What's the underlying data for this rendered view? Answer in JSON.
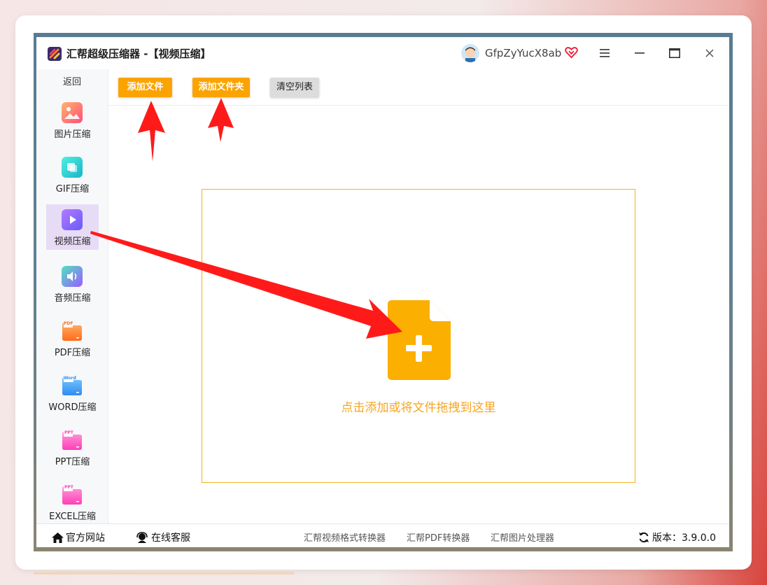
{
  "window": {
    "title": "汇帮超级压缩器 -【视频压缩】"
  },
  "user": {
    "name": "GfpZyYucX8ab"
  },
  "sidebar": {
    "back_label": "返回",
    "items": [
      {
        "label": "图片压缩",
        "icon": "image-icon"
      },
      {
        "label": "GIF压缩",
        "icon": "gif-icon"
      },
      {
        "label": "视频压缩",
        "icon": "video-play-icon",
        "active": true
      },
      {
        "label": "音频压缩",
        "icon": "audio-speaker-icon"
      },
      {
        "label": "PDF压缩",
        "icon": "pdf-folder-icon",
        "badge": "PDF"
      },
      {
        "label": "WORD压缩",
        "icon": "word-folder-icon",
        "badge": "Word"
      },
      {
        "label": "PPT压缩",
        "icon": "ppt-folder-icon",
        "badge": "PPT"
      },
      {
        "label": "EXCEL压缩",
        "icon": "excel-folder-icon",
        "badge": "PPT"
      }
    ]
  },
  "toolbar": {
    "add_file": "添加文件",
    "add_folder": "添加文件夹",
    "clear_list": "清空列表"
  },
  "dropzone": {
    "text": "点击添加或将文件拖拽到这里"
  },
  "footer": {
    "website": "官方网站",
    "support": "在线客服",
    "links": [
      "汇帮视频格式转换器",
      "汇帮PDF转换器",
      "汇帮图片处理器"
    ],
    "version": "版本：3.9.0.0"
  },
  "colors": {
    "accent_orange": "#fba300",
    "dropzone_border": "#f2b21f",
    "active_sidebar": "#e7dcf5",
    "annotation_red": "#ff1a1a"
  }
}
